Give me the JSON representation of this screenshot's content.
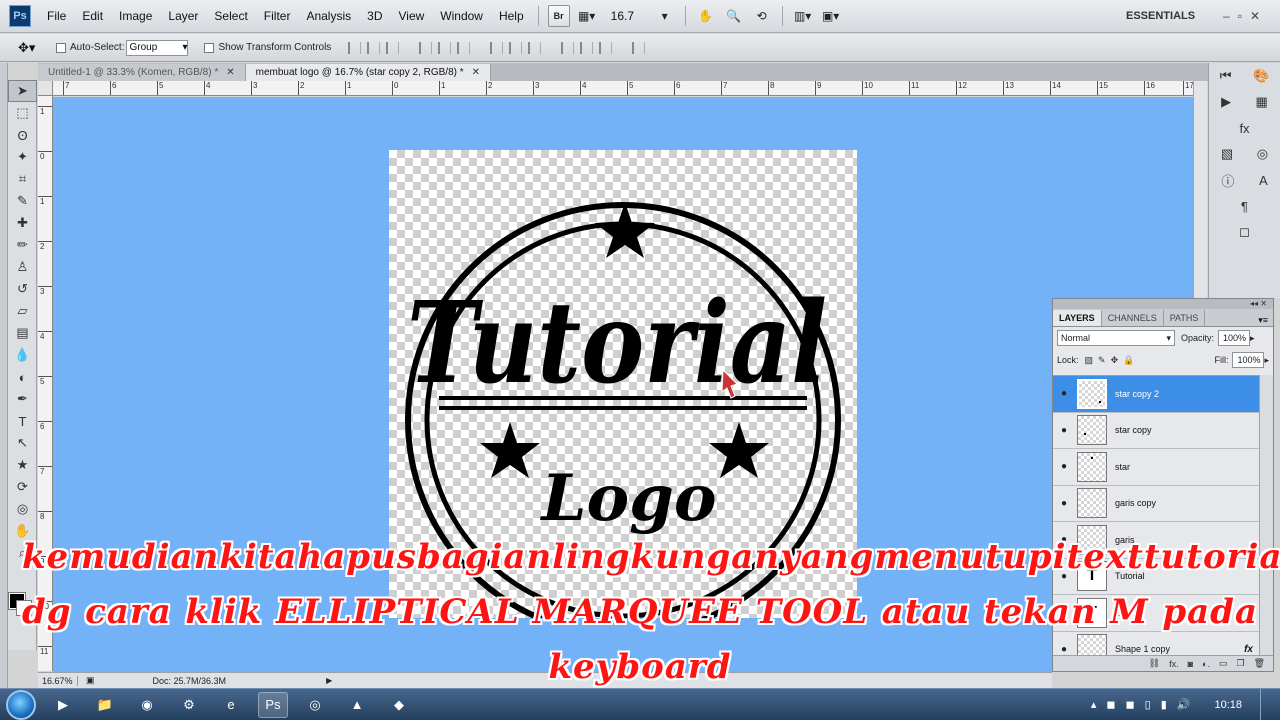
{
  "app": {
    "logo": "Ps"
  },
  "menubar": {
    "items": [
      "File",
      "Edit",
      "Image",
      "Layer",
      "Select",
      "Filter",
      "Analysis",
      "3D",
      "View",
      "Window",
      "Help"
    ],
    "bridge_label": "Br",
    "zoom_value": "16.7",
    "workspace": "ESSENTIALS"
  },
  "options": {
    "auto_select_label": "Auto-Select:",
    "auto_select_value": "Group",
    "show_transform_label": "Show Transform Controls"
  },
  "tabs": [
    {
      "label": "Untitled-1 @ 33.3% (Komen, RGB/8) *",
      "active": false
    },
    {
      "label": "membuat logo @ 16.7% (star copy 2, RGB/8) *",
      "active": true
    }
  ],
  "ruler": {
    "top_labels": [
      "7",
      "6",
      "5",
      "4",
      "3",
      "2",
      "1",
      "0",
      "1",
      "2",
      "3",
      "4",
      "5",
      "6",
      "7",
      "8",
      "9",
      "10",
      "11",
      "12",
      "13",
      "14",
      "15",
      "16",
      "17"
    ],
    "left_labels": [
      "1",
      "0",
      "1",
      "2",
      "3",
      "4",
      "5",
      "6",
      "7",
      "8",
      "9",
      "10",
      "11",
      "12"
    ]
  },
  "canvas": {
    "logo_text_main": "Tutorial",
    "logo_text_sub": "Logo"
  },
  "status": {
    "zoom": "16.67%",
    "doc_info": "Doc: 25.7M/36.3M"
  },
  "layers_panel": {
    "tabs": [
      "LAYERS",
      "CHANNELS",
      "PATHS"
    ],
    "blend_mode": "Normal",
    "opacity_label": "Opacity:",
    "opacity_value": "100%",
    "lock_label": "Lock:",
    "fill_label": "Fill:",
    "fill_value": "100%",
    "layers": [
      {
        "name": "star copy 2",
        "selected": true,
        "thumb": "star"
      },
      {
        "name": "star copy",
        "selected": false,
        "thumb": "star"
      },
      {
        "name": "star",
        "selected": false,
        "thumb": "star"
      },
      {
        "name": "garis copy",
        "selected": false,
        "thumb": "line"
      },
      {
        "name": "garis",
        "selected": false,
        "thumb": "line"
      },
      {
        "name": "Tutorial",
        "selected": false,
        "thumb": "T"
      },
      {
        "name": "Logo",
        "selected": false,
        "thumb": "T"
      },
      {
        "name": "Shape 1 copy",
        "selected": false,
        "thumb": "shape",
        "fx": "fx"
      }
    ]
  },
  "subtitle": {
    "line1": [
      "kemudian",
      "kita",
      "hapus",
      "bagian",
      "lingkungan",
      "yang",
      "menutupi",
      "text",
      "tutorial"
    ],
    "line2": [
      "dg",
      "cara",
      "klik",
      "ELLIPTICAL MARQUEE TOOL",
      "atau",
      "tekan",
      "M",
      "pada"
    ],
    "line3": "keyboard"
  },
  "taskbar": {
    "clock": "10:18"
  },
  "colors": {
    "canvas_bg": "#74b2f8",
    "subtitle": "#ff1414",
    "selection": "#3d8ee6"
  }
}
